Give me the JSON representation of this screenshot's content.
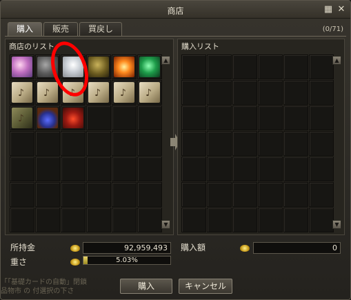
{
  "window": {
    "title": "商店"
  },
  "titlebar_icons": [
    "grid-settings-icon",
    "close-icon"
  ],
  "tabs": [
    {
      "label": "購入",
      "active": true
    },
    {
      "label": "販売",
      "active": false
    },
    {
      "label": "買戻し",
      "active": false
    }
  ],
  "inventory_count": "(0/71)",
  "shop_list": {
    "label": "商店のリスト",
    "items": [
      "pink-crystal-icon",
      "ore-icon",
      "white-crystal-icon",
      "gold-orb-icon",
      "fire-orb-icon",
      "green-gem-icon",
      "recipe-scroll-icon",
      "recipe-scroll-icon",
      "recipe-scroll-icon",
      "recipe-scroll-icon",
      "recipe-scroll-icon",
      "recipe-scroll-icon",
      "dark-scroll-icon",
      "blue-potion-icon",
      "red-potion-icon"
    ]
  },
  "buy_list": {
    "label": "購入リスト"
  },
  "footer": {
    "money_label": "所持金",
    "money_value": "92,959,493",
    "weight_label": "重さ",
    "weight_value": "5.03%",
    "weight_fraction": 0.0503,
    "purchase_label": "購入額",
    "purchase_value": "0"
  },
  "buttons": {
    "buy": "購入",
    "cancel": "キャンセル"
  },
  "background_text": {
    "line1": "「「基礎カードの自動」閉鎖",
    "line2": "品物市  の  付選択の下さ"
  },
  "colors": {
    "highlight_circle": "#ff0000",
    "coin": "#e8c43a"
  }
}
